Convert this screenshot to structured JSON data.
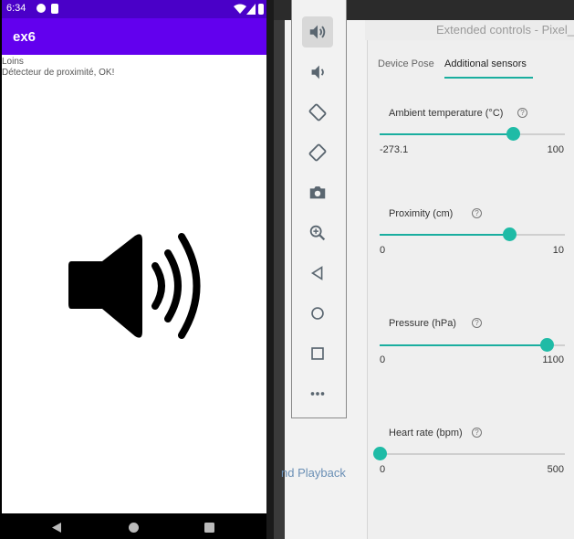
{
  "status_bar": {
    "time": "6:34"
  },
  "app": {
    "title": "ex6",
    "lines": [
      "Loins",
      "Détecteur de proximité, OK!"
    ],
    "main_icon": "speaker-volume-icon"
  },
  "nav_bar": {
    "icons": [
      "back-icon",
      "home-icon",
      "recents-icon"
    ]
  },
  "background": {
    "partial_text": "nd Playback"
  },
  "toolbar": {
    "buttons": [
      "volume-up-icon",
      "volume-down-icon",
      "rotate-left-icon",
      "rotate-right-icon",
      "camera-icon",
      "zoom-icon",
      "back-icon",
      "home-icon",
      "overview-icon",
      "more-icon"
    ],
    "active": "volume-up-icon"
  },
  "extended_controls": {
    "title": "Extended controls - Pixel_",
    "tabs": [
      {
        "label": "Device Pose",
        "selected": false
      },
      {
        "label": "Additional sensors",
        "selected": true
      }
    ],
    "sensors": [
      {
        "label": "Ambient temperature (°C)",
        "min": "-273.1",
        "max": "100",
        "value_fraction": 0.72
      },
      {
        "label": "Proximity (cm)",
        "min": "0",
        "max": "10",
        "value_fraction": 0.7
      },
      {
        "label": "Pressure (hPa)",
        "min": "0",
        "max": "1100",
        "value_fraction": 0.9
      },
      {
        "label": "Heart rate (bpm)",
        "min": "0",
        "max": "500",
        "value_fraction": 0.0
      }
    ],
    "accent_color": "#1aae9f"
  }
}
